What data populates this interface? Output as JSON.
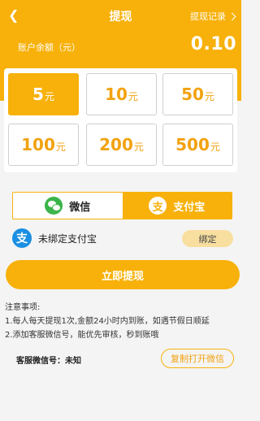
{
  "header": {
    "title": "提现",
    "record_link": "提现记录",
    "balance_label": "账户余额（元）",
    "balance_value": "0.10"
  },
  "amounts": [
    {
      "num": "5",
      "unit": "元",
      "selected": true
    },
    {
      "num": "10",
      "unit": "元",
      "selected": false
    },
    {
      "num": "50",
      "unit": "元",
      "selected": false
    },
    {
      "num": "100",
      "unit": "元",
      "selected": false
    },
    {
      "num": "200",
      "unit": "元",
      "selected": false
    },
    {
      "num": "500",
      "unit": "元",
      "selected": false
    }
  ],
  "payment": {
    "wechat_label": "微信",
    "alipay_label": "支付宝",
    "alipay_icon_char": "支",
    "active": "alipay"
  },
  "bind": {
    "text": "未绑定支付宝",
    "button": "绑定"
  },
  "withdraw_button": "立即提现",
  "notes": {
    "title": "注意事项:",
    "items": [
      "1.每人每天提现1次,金额24小时内到账，如遇节假日顺延",
      "2.添加客服微信号，能优先审核，秒到账哦"
    ]
  },
  "contact": {
    "text": "客服微信号：未知",
    "button": "复制打开微信"
  },
  "colors": {
    "accent": "#f7b10a",
    "wechat": "#3bb54a",
    "alipay": "#1a8fe3"
  }
}
